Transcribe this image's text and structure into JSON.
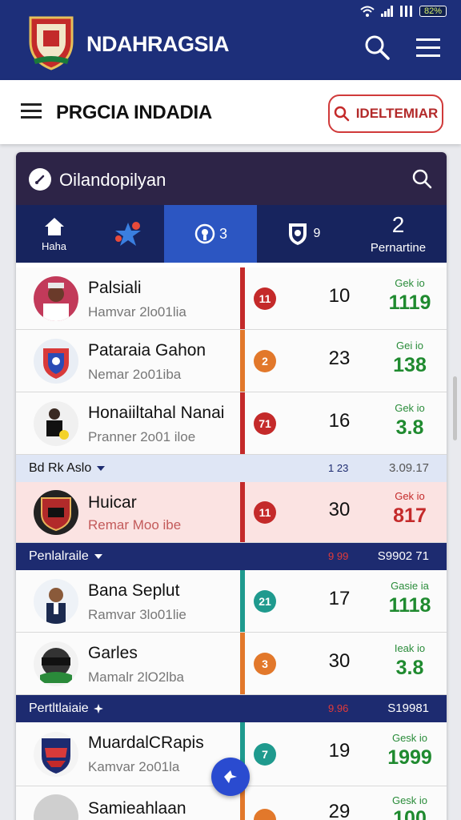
{
  "status": {
    "battery": "82%"
  },
  "app": {
    "title": "NDAHRAGSIA"
  },
  "subheader": {
    "title": "PRGCIA INDADIA",
    "button_label": "IDELTEMIAR"
  },
  "card": {
    "title": "Oilandopilyan"
  },
  "tabs": [
    {
      "label": "Haha"
    },
    {
      "label": ""
    },
    {
      "label": "3"
    },
    {
      "label": "9"
    },
    {
      "number": "2",
      "label": "Pernartine"
    }
  ],
  "rows": [
    {
      "name": "Palsiali",
      "sub": "Hamvar 2lo01lia",
      "badge": "11",
      "value": "10",
      "stat_label": "Gek io",
      "stat_value": "1119"
    },
    {
      "name": "Pataraia Gahon",
      "sub": "Nemar 2o01iba",
      "badge": "2",
      "value": "23",
      "stat_label": "Gei io",
      "stat_value": "138"
    },
    {
      "name": "Honaiiltahal Nanai",
      "sub": "Pranner 2o01 iloe",
      "badge": "71",
      "value": "16",
      "stat_label": "Gek io",
      "stat_value": "3.8"
    },
    {
      "name": "Huicar",
      "sub": "Remar Moo ibe",
      "badge": "11",
      "value": "30",
      "stat_label": "Gek io",
      "stat_value": "817"
    },
    {
      "name": "Bana Seplut",
      "sub": "Ramvar 3lo01lie",
      "badge": "21",
      "value": "17",
      "stat_label": "Gasie ia",
      "stat_value": "1118"
    },
    {
      "name": "Garles",
      "sub": "Mamalr 2lO2lba",
      "badge": "3",
      "value": "30",
      "stat_label": "Ieak io",
      "stat_value": "3.8"
    },
    {
      "name": "MuardalCRapis",
      "sub": "Kamvar 2o01la",
      "badge": "7",
      "value": "19",
      "stat_label": "Gesk io",
      "stat_value": "1999"
    },
    {
      "name": "Samieahlaan",
      "sub": "",
      "badge": "",
      "value": "29",
      "stat_label": "Gesk io",
      "stat_value": "100"
    }
  ],
  "sections": [
    {
      "label": "Bd Rk Aslo",
      "mid": "1 23",
      "right": "3.09.17"
    },
    {
      "label": "Penlalraile",
      "mid": "9 99",
      "right": "S9902 71"
    },
    {
      "label": "Pertltlaiaie",
      "mid": "9.96",
      "right": "S19981"
    }
  ],
  "colors": {
    "appbar": "#1d2f7a",
    "card_head": "#2d2447",
    "tabs": "#17245e",
    "tab_active": "#2c56c2",
    "red": "#c42a2a",
    "orange": "#e2782b",
    "teal": "#1f9a8e",
    "green": "#1f8a2f"
  },
  "icons": [
    "crest-logo",
    "search-icon",
    "menu-icon",
    "home-icon",
    "star-figure-icon",
    "shield-icon",
    "fab-icon"
  ]
}
